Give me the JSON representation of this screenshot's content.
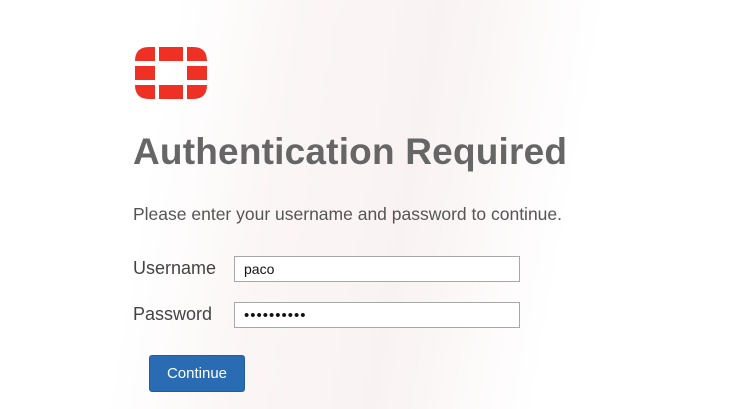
{
  "brand": {
    "logo": "fortinet-logo",
    "logo_color": "#ee3124"
  },
  "page": {
    "title": "Authentication Required",
    "subtitle": "Please enter your username and password to continue."
  },
  "form": {
    "username_label": "Username",
    "username_value": "paco",
    "password_label": "Password",
    "password_value": "••••••••••",
    "continue_label": "Continue"
  },
  "colors": {
    "button": "#2a6cb4",
    "title_text": "#666666"
  }
}
